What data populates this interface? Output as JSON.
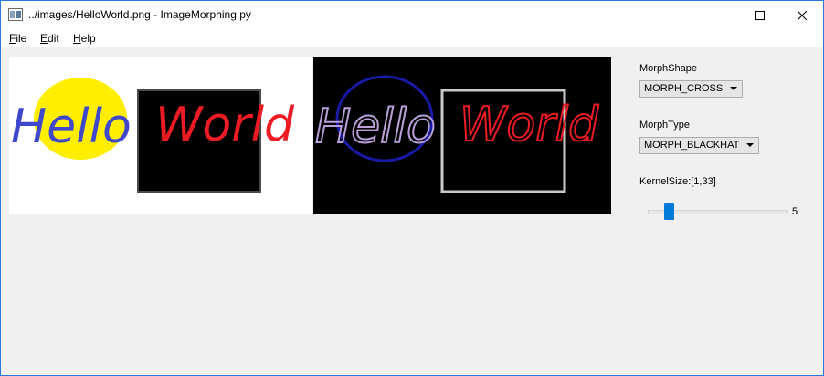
{
  "window": {
    "title": "../images/HelloWorld.png - ImageMorphing.py",
    "controls": [
      "minimize-icon",
      "maximize-icon",
      "close-icon"
    ]
  },
  "menu": {
    "file": {
      "accel": "F",
      "rest": "ile"
    },
    "edit": {
      "accel": "E",
      "rest": "dit"
    },
    "help": {
      "accel": "H",
      "rest": "elp"
    }
  },
  "images": {
    "original": {
      "word1": "Hello",
      "word2": "World",
      "colors": {
        "background": "#ffffff",
        "circle": "#ffee00",
        "hello": "#3f48cc",
        "world": "#ed1c24",
        "box": "#000000"
      }
    },
    "result": {
      "word1": "Hello",
      "word2": "World",
      "colors": {
        "background": "#000000",
        "circle": "#1a1aa8",
        "world": "#ed1c24",
        "box": "#c8c8c8",
        "d": "#40e0d0"
      }
    }
  },
  "controls": {
    "morph_shape": {
      "label": "MorphShape",
      "value": "MORPH_CROSS"
    },
    "morph_type": {
      "label": "MorphType",
      "value": "MORPH_BLACKHAT"
    },
    "kernel_size": {
      "label": "KernelSize:[1,33]",
      "value": "5",
      "min": 1,
      "max": 33,
      "current": 5
    },
    "accent": "#007ad9"
  }
}
